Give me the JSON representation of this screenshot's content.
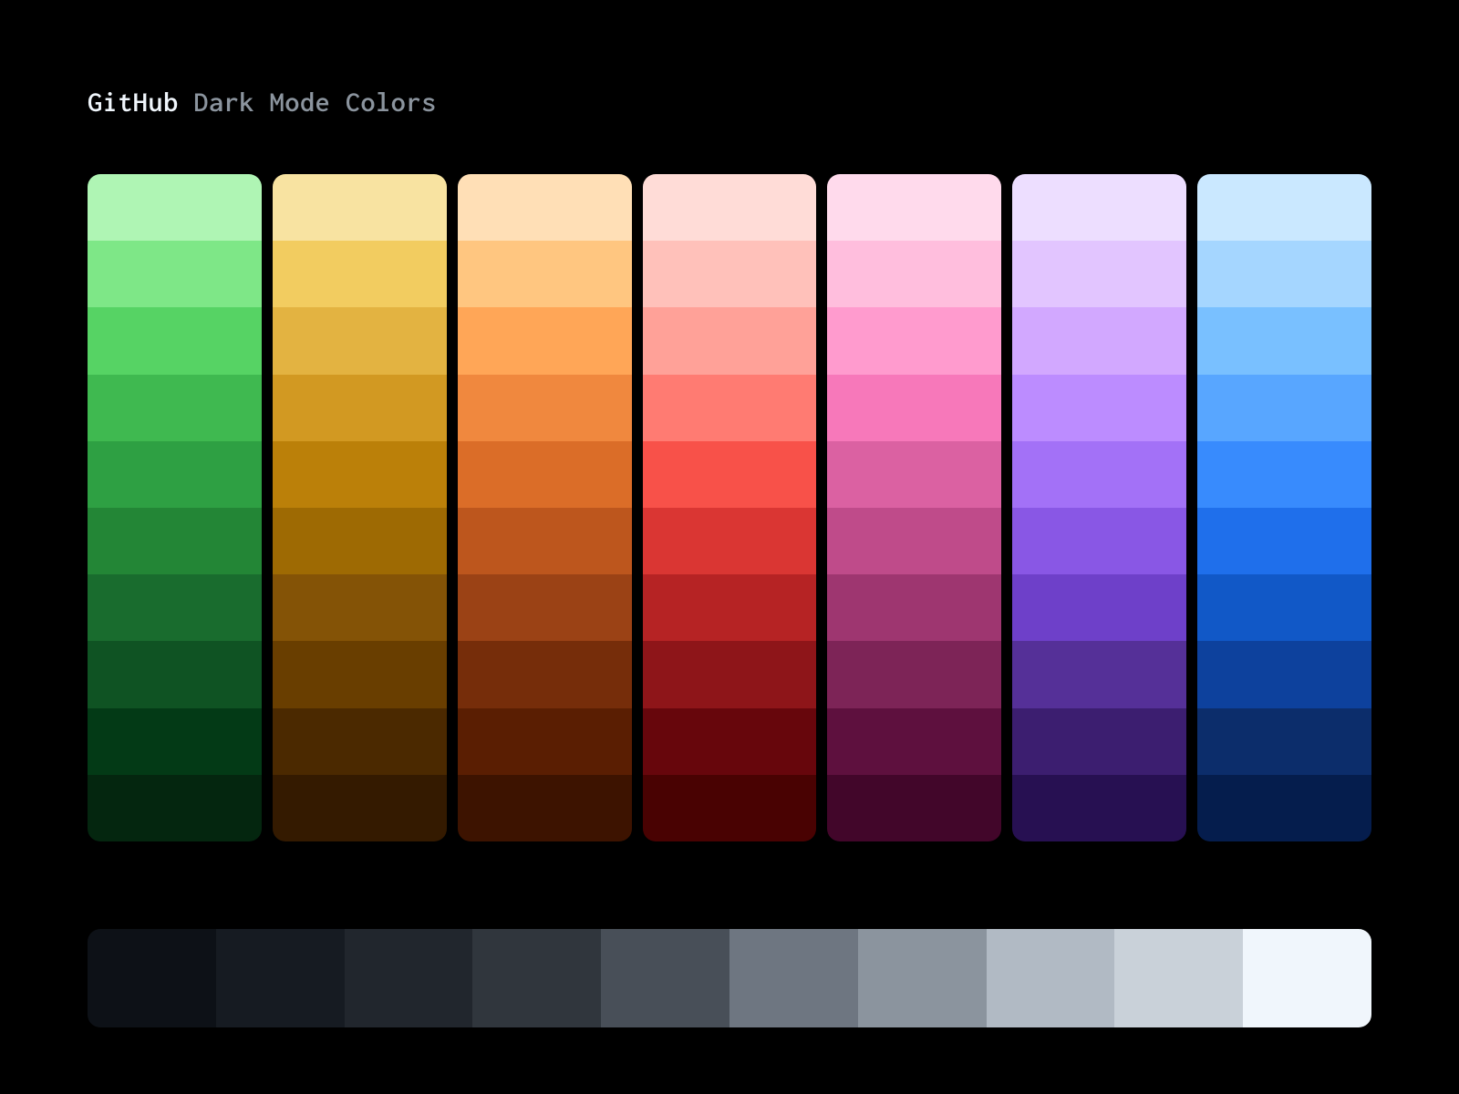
{
  "title": {
    "strong": "GitHub",
    "muted": " Dark Mode Colors"
  },
  "palettes": [
    {
      "name": "green",
      "shades": [
        "#AFF5B4",
        "#7EE787",
        "#56D364",
        "#3FB950",
        "#2EA043",
        "#238636",
        "#196C2E",
        "#0F5323",
        "#033A16",
        "#04260F"
      ]
    },
    {
      "name": "yellow",
      "shades": [
        "#F8E3A1",
        "#F2CC60",
        "#E3B341",
        "#D29922",
        "#BB8009",
        "#9E6A03",
        "#845306",
        "#693E00",
        "#4B2900",
        "#341A00"
      ]
    },
    {
      "name": "orange",
      "shades": [
        "#FFDFB6",
        "#FFC680",
        "#FFA657",
        "#F0883E",
        "#DB6D28",
        "#BD561D",
        "#9B4215",
        "#762D0A",
        "#5A1E02",
        "#3D1300"
      ]
    },
    {
      "name": "red",
      "shades": [
        "#FFDCD7",
        "#FFC1BA",
        "#FFA198",
        "#FF7B72",
        "#F85149",
        "#DA3633",
        "#B62324",
        "#8E1519",
        "#67060C",
        "#490202"
      ]
    },
    {
      "name": "pink",
      "shades": [
        "#FFDAEC",
        "#FFBEDD",
        "#FF9BCE",
        "#F778BA",
        "#DB61A2",
        "#BF4B8A",
        "#9E3670",
        "#7D2457",
        "#5E103E",
        "#42062A"
      ]
    },
    {
      "name": "purple",
      "shades": [
        "#EDDEFF",
        "#E2C5FF",
        "#D2A8FF",
        "#BC8CFF",
        "#A371F7",
        "#8957E5",
        "#6E40C9",
        "#553098",
        "#3C1E70",
        "#271052"
      ]
    },
    {
      "name": "blue",
      "shades": [
        "#CAE8FF",
        "#A5D6FF",
        "#79C0FF",
        "#58A6FF",
        "#388BFD",
        "#1F6FEB",
        "#1158C7",
        "#0D419D",
        "#0C2D6B",
        "#051D4D"
      ]
    }
  ],
  "grays": [
    "#0D1117",
    "#161B22",
    "#21262D",
    "#30363D",
    "#484F58",
    "#6E7681",
    "#8B949E",
    "#B1BAC4",
    "#C9D1D9",
    "#F0F6FC"
  ]
}
